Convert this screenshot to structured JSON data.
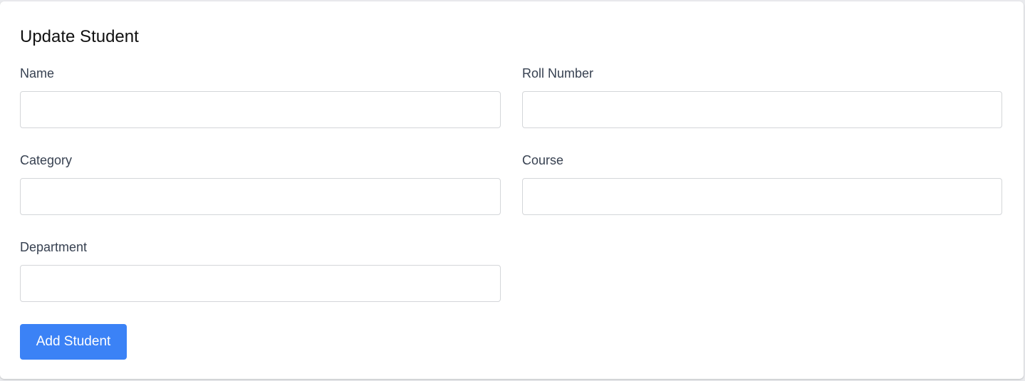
{
  "form": {
    "title": "Update Student",
    "fields": {
      "name": {
        "label": "Name",
        "value": "",
        "placeholder": ""
      },
      "roll_number": {
        "label": "Roll Number",
        "value": "",
        "placeholder": ""
      },
      "category": {
        "label": "Category",
        "value": "",
        "placeholder": ""
      },
      "course": {
        "label": "Course",
        "value": "",
        "placeholder": ""
      },
      "department": {
        "label": "Department",
        "value": "",
        "placeholder": ""
      }
    },
    "submit_label": "Add Student"
  },
  "colors": {
    "primary": "#3b82f6",
    "label": "#374151",
    "border": "#d4d6d9",
    "background": "#e9eaed",
    "card": "#ffffff"
  }
}
